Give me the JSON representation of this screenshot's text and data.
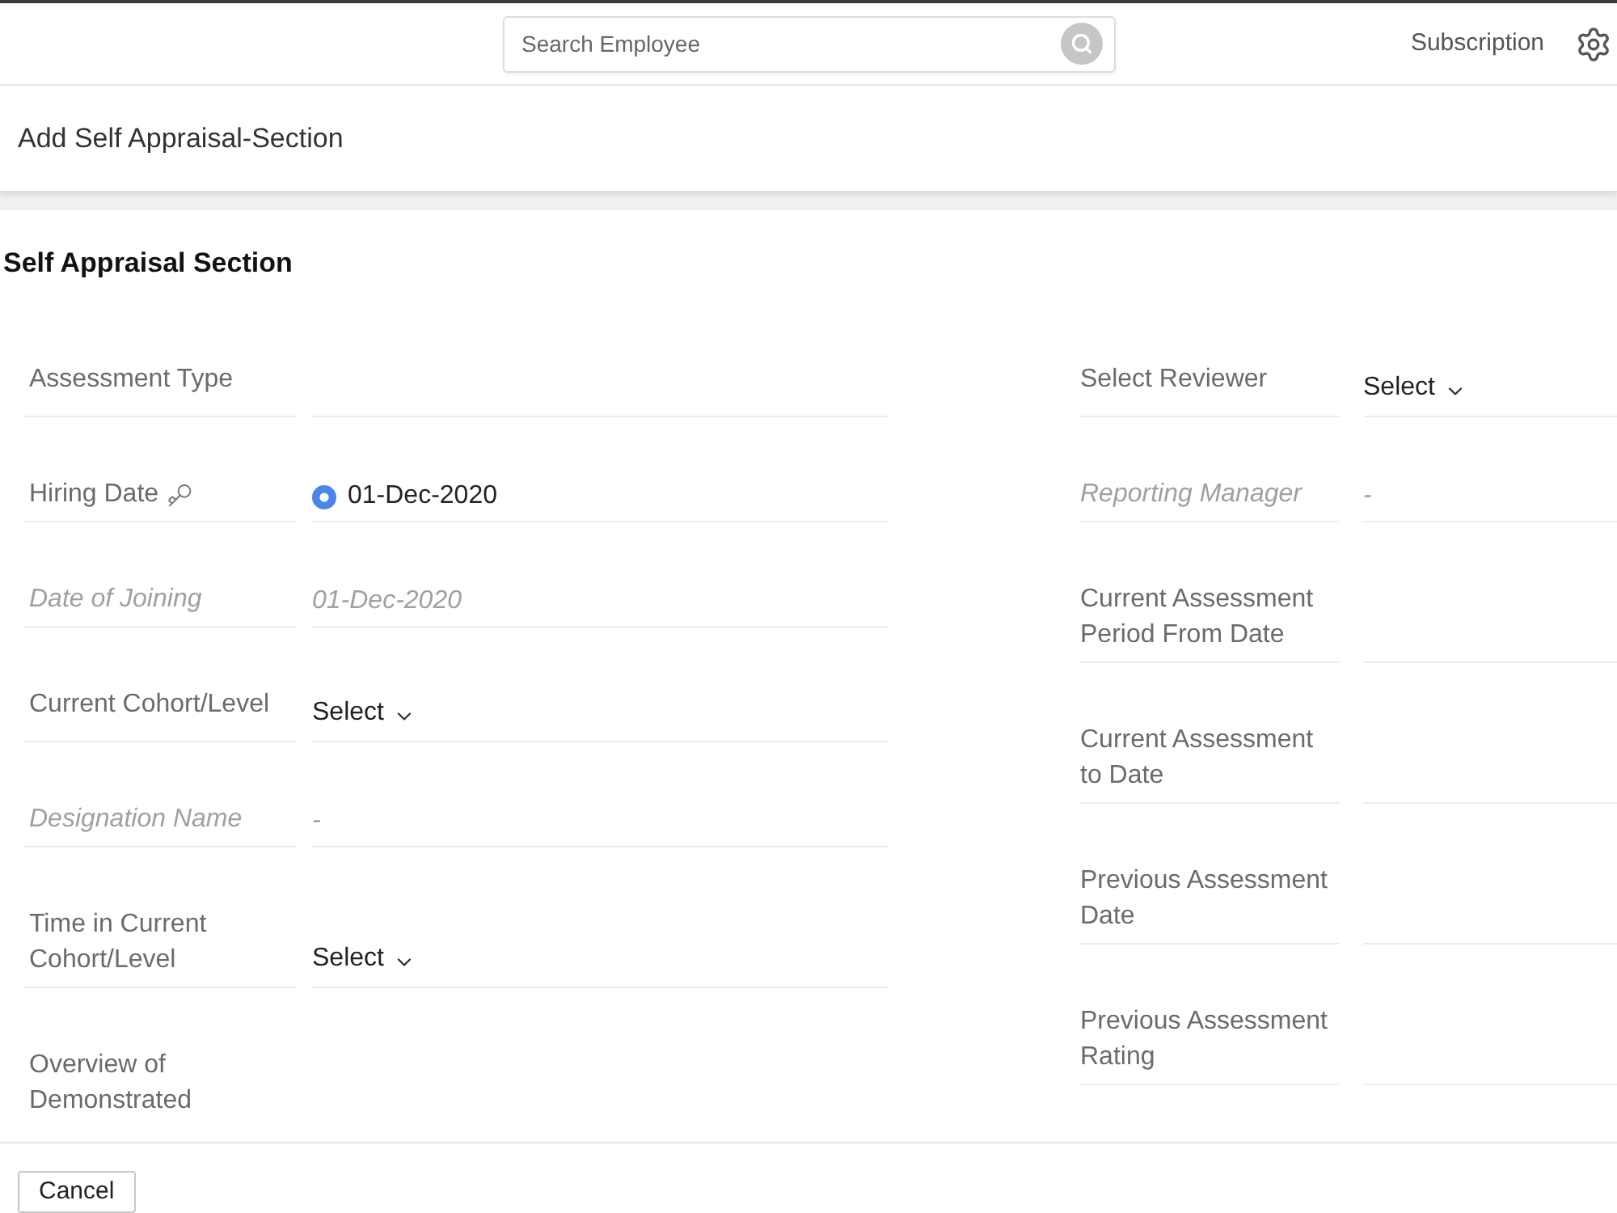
{
  "top_bar": {
    "search": {
      "placeholder": "Search Employee"
    },
    "subscription_link": "Subscription"
  },
  "page_title": "Add Self Appraisal-Section",
  "section_title": "Self Appraisal Section",
  "left_fields": [
    {
      "kind": "empty",
      "label": "Assessment Type",
      "secured": false
    },
    {
      "kind": "radio",
      "label": "Hiring Date",
      "secured": true,
      "selected": true,
      "value": "01-Dec-2020"
    },
    {
      "kind": "readonly",
      "label": "Date of Joining",
      "secured": false,
      "value": "01-Dec-2020"
    },
    {
      "kind": "select",
      "label": "Current Cohort/Level",
      "secured": false,
      "value": "Select"
    },
    {
      "kind": "readonly",
      "label": "Designation Name",
      "secured": false,
      "value": "-"
    },
    {
      "kind": "select",
      "label": "Time in Current Cohort/Level",
      "secured": false,
      "value": "Select"
    },
    {
      "kind": "empty",
      "label": "Overview of Demonstrated",
      "secured": false
    }
  ],
  "right_fields": [
    {
      "kind": "select",
      "label": "Select Reviewer",
      "secured": false,
      "value": "Select"
    },
    {
      "kind": "readonly",
      "label": "Reporting Manager",
      "secured": false,
      "value": "-"
    },
    {
      "kind": "empty",
      "label": "Current Assessment Period From Date",
      "secured": false
    },
    {
      "kind": "empty",
      "label": "Current Assessment to Date",
      "secured": false
    },
    {
      "kind": "empty",
      "label": "Previous Assessment Date",
      "secured": false
    },
    {
      "kind": "empty",
      "label": "Previous Assessment Rating",
      "secured": false
    }
  ],
  "footer": {
    "buttons": [
      "Cancel"
    ]
  }
}
